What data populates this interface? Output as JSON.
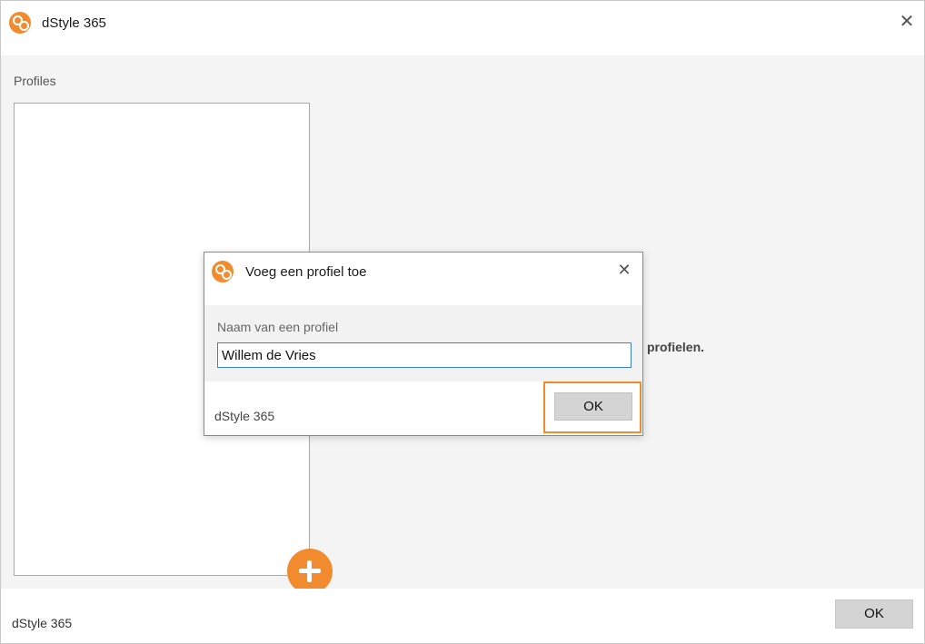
{
  "window": {
    "title": "dStyle 365",
    "close_icon": "close-icon",
    "logo_icon": "dstyle-logo-icon"
  },
  "main": {
    "profiles_label": "Profiles",
    "hint_text": "profielen.",
    "add_icon": "plus-icon"
  },
  "footer": {
    "brand": "dStyle 365",
    "ok_label": "OK"
  },
  "dialog": {
    "title": "Voeg een profiel toe",
    "field_label": "Naam van een profiel",
    "field_value": "Willem de Vries",
    "brand": "dStyle 365",
    "ok_label": "OK"
  },
  "colors": {
    "accent": "#f28a2e",
    "input_focus": "#3d7fd6",
    "button_bg": "#d4d4d4"
  }
}
